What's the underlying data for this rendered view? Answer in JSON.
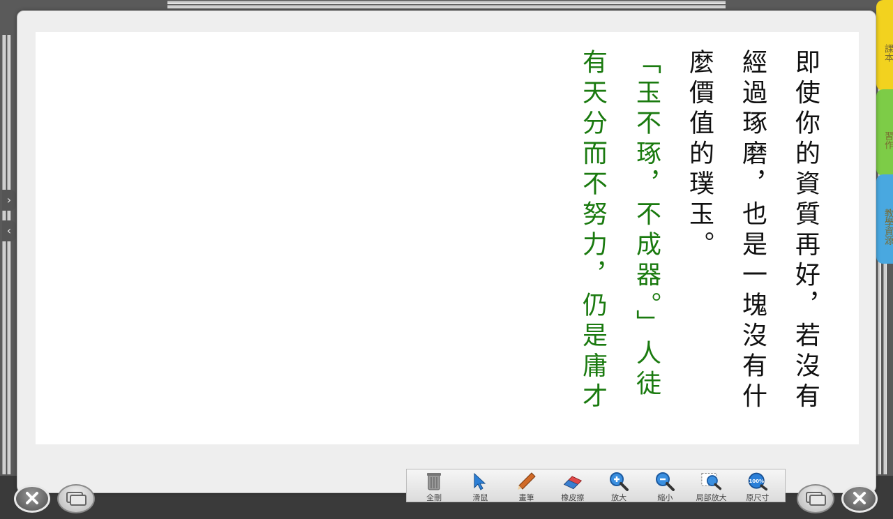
{
  "tool_palette": {
    "items": [
      {
        "label": "全刪",
        "icon": "trash-icon"
      },
      {
        "label": "滑鼠",
        "icon": "cursor-icon"
      },
      {
        "label": "畫筆",
        "icon": "pencil-icon"
      },
      {
        "label": "橡皮擦",
        "icon": "eraser-icon"
      },
      {
        "label": "放大",
        "icon": "zoom-in-icon"
      },
      {
        "label": "縮小",
        "icon": "zoom-out-icon"
      },
      {
        "label": "局部放大",
        "icon": "partial-zoom-icon"
      },
      {
        "label": "原尺寸",
        "icon": "original-size-icon",
        "badge": "100%"
      }
    ]
  },
  "content": {
    "columns": [
      {
        "text": "即使你的資質再好，若沒有",
        "color": "#111111"
      },
      {
        "text": "經過琢磨，也是一塊沒有什",
        "color": "#111111"
      },
      {
        "text": "麼價值的璞玉。",
        "color": "#111111"
      },
      {
        "text": "「玉不琢，不成器。」人徒",
        "color": "#1a7a0f"
      },
      {
        "text": "有天分而不努力，仍是庸才",
        "color": "#1a7a0f"
      }
    ]
  },
  "side_tabs": [
    {
      "label": "課本",
      "color": "#f2d21f"
    },
    {
      "label": "習作",
      "color": "#7dcc47"
    },
    {
      "label": "教學資源",
      "color": "#49a8e0"
    }
  ],
  "nav": {
    "expand_glyph": "›",
    "collapse_glyph": "‹"
  },
  "colors": {
    "body_text": "#111111",
    "quote_text": "#1a7a0f"
  }
}
